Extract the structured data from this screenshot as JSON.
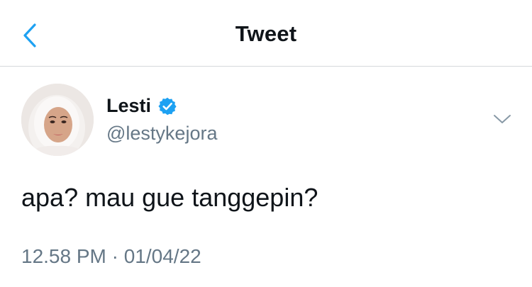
{
  "header": {
    "back_icon": "chevron-left-icon",
    "title": "Tweet"
  },
  "tweet": {
    "author": {
      "name": "Lesti",
      "handle": "@lestykejora",
      "verified": true,
      "verified_icon": "verified-badge-icon"
    },
    "menu_icon": "chevron-down-icon",
    "text": "apa? mau gue tanggepin?",
    "meta": "12.58 PM · 01/04/22"
  },
  "colors": {
    "accent": "#1da1f2",
    "text_primary": "#0f1419",
    "text_secondary": "#657786",
    "divider": "#d5d8db"
  }
}
